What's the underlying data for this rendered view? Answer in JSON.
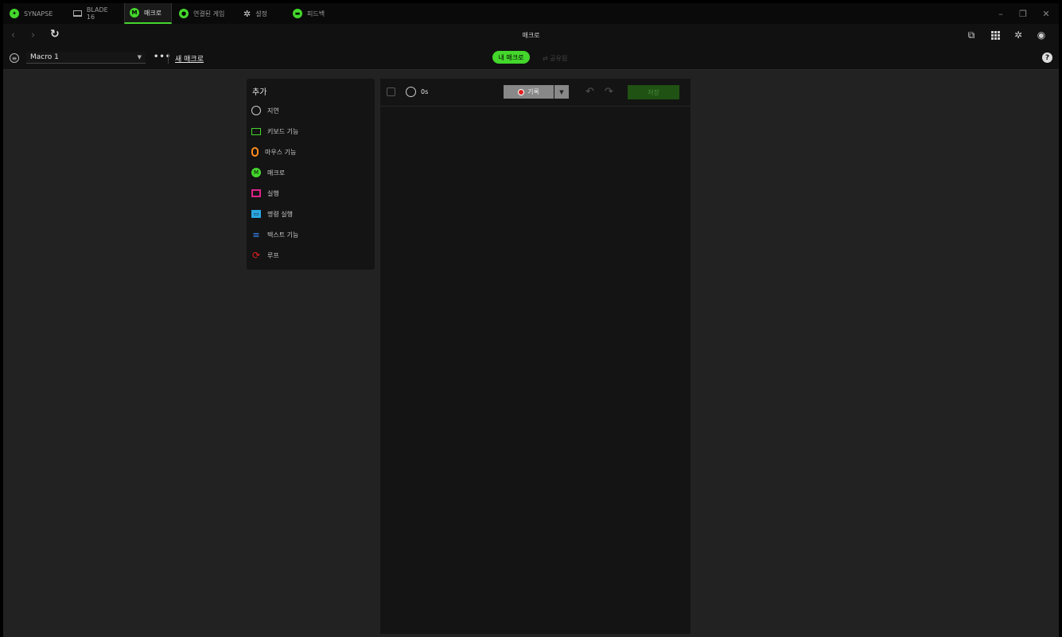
{
  "window": {
    "tabs": [
      {
        "label": "SYNAPSE",
        "icon": "razer-logo-icon"
      },
      {
        "label": "BLADE 16",
        "icon": "laptop-icon"
      },
      {
        "label": "매크로",
        "icon": "macro-icon",
        "badge": "M"
      },
      {
        "label": "연결된 게임",
        "icon": "gamepad-icon"
      },
      {
        "label": "설정",
        "icon": "gear-icon"
      },
      {
        "label": "피드백",
        "icon": "feedback-icon"
      }
    ],
    "active_tab": "매크로",
    "controls": {
      "minimize": "–",
      "maximize": "❐",
      "close": "✕"
    }
  },
  "nav": {
    "title": "매크로",
    "back": "‹",
    "forward": "›",
    "refresh": "↻",
    "right_icons": [
      "profile-sync-icon",
      "apps-grid-icon",
      "settings-icon",
      "account-icon"
    ]
  },
  "toolbar": {
    "selected_macro": "Macro 1",
    "more": "•••",
    "new_macro": "새 매크로",
    "tab_mine": "내 매크로",
    "tab_shared": "공유됨",
    "help": "?"
  },
  "add_panel": {
    "title": "추가",
    "items": [
      {
        "label": "지연",
        "icon": "clock-icon",
        "color": "#cccccc"
      },
      {
        "label": "키보드 기능",
        "icon": "keyboard-icon",
        "color": "#44d62c"
      },
      {
        "label": "마우스 기능",
        "icon": "mouse-icon",
        "color": "#ff8c1a"
      },
      {
        "label": "매크로",
        "icon": "macro-icon",
        "color": "#44d62c"
      },
      {
        "label": "실행",
        "icon": "launch-icon",
        "color": "#e0218a"
      },
      {
        "label": "명령 실행",
        "icon": "terminal-icon",
        "color": "#2aa6e0"
      },
      {
        "label": "텍스트 기능",
        "icon": "text-icon",
        "color": "#3c8cff"
      },
      {
        "label": "루프",
        "icon": "loop-icon",
        "color": "#e02020"
      }
    ]
  },
  "editor": {
    "duration": "0s",
    "record_label": "기록",
    "save_label": "저장"
  },
  "colors": {
    "accent": "#44d62c",
    "background": "#222222",
    "panel": "#141414"
  }
}
